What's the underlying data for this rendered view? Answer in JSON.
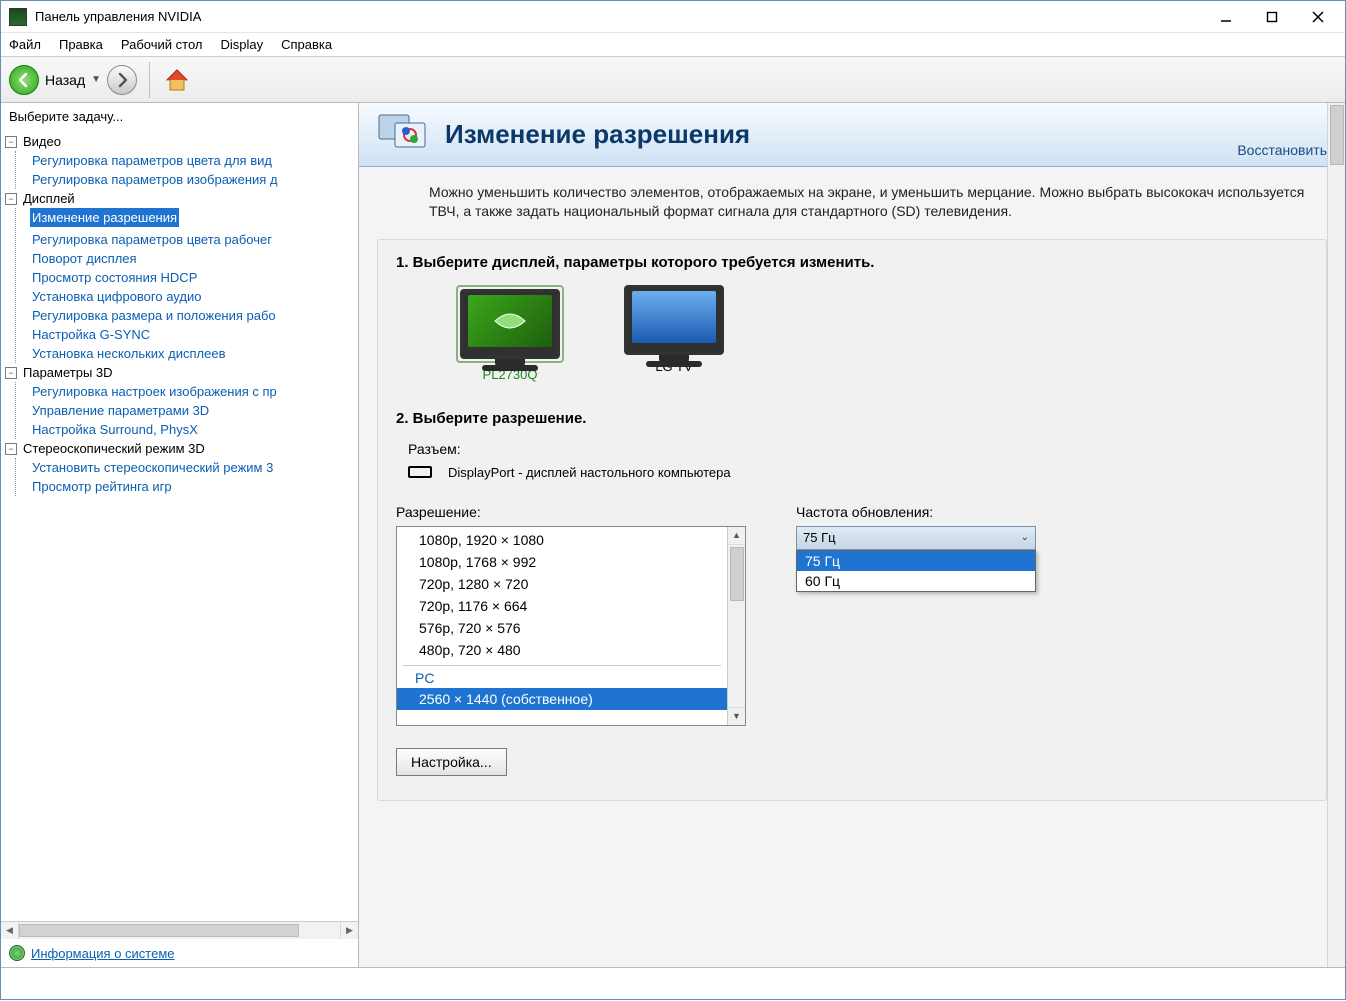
{
  "window": {
    "title": "Панель управления NVIDIA"
  },
  "menu": {
    "file": "Файл",
    "edit": "Правка",
    "desktop": "Рабочий стол",
    "display": "Display",
    "help": "Справка"
  },
  "toolbar": {
    "back_label": "Назад"
  },
  "sidebar": {
    "title": "Выберите задачу...",
    "groups": [
      {
        "label": "Видео",
        "items": [
          "Регулировка параметров цвета для вид",
          "Регулировка параметров изображения д"
        ]
      },
      {
        "label": "Дисплей",
        "items": [
          "Изменение разрешения",
          "Регулировка параметров цвета рабочег",
          "Поворот дисплея",
          "Просмотр состояния HDCP",
          "Установка цифрового аудио",
          "Регулировка размера и положения рабо",
          "Настройка G-SYNC",
          "Установка нескольких дисплеев"
        ],
        "selected": 0
      },
      {
        "label": "Параметры 3D",
        "items": [
          "Регулировка настроек изображения с пр",
          "Управление параметрами 3D",
          "Настройка Surround, PhysX"
        ]
      },
      {
        "label": "Стереоскопический режим 3D",
        "items": [
          "Установить стереоскопический режим 3",
          "Просмотр рейтинга игр"
        ]
      }
    ],
    "footer_link": "Информация о системе"
  },
  "main": {
    "title": "Изменение разрешения",
    "restore": "Восстановить",
    "description": "Можно уменьшить количество элементов, отображаемых на экране, и уменьшить мерцание. Можно выбрать высококач используется ТВЧ, а также задать национальный формат сигнала для стандартного (SD) телевидения.",
    "step1_heading": "1. Выберите дисплей, параметры которого требуется изменить.",
    "displays": [
      {
        "name": "PL2730Q",
        "selected": true
      },
      {
        "name": "LG TV",
        "selected": false
      }
    ],
    "step2_heading": "2. Выберите разрешение.",
    "connector_label": "Разъем:",
    "connector_value": "DisplayPort - дисплей настольного компьютера",
    "resolution_label": "Разрешение:",
    "resolutions_visible": [
      "1080p, 1920 × 1080",
      "1080p, 1768 × 992",
      "720p, 1280 × 720",
      "720p, 1176 × 664",
      "576p, 720 × 576",
      "480p, 720 × 480"
    ],
    "resolution_group_label": "PC",
    "resolution_selected": "2560 × 1440 (собственное)",
    "refresh_label": "Частота обновления:",
    "refresh_selected": "75 Гц",
    "refresh_options": [
      "75 Гц",
      "60 Гц"
    ],
    "customize_button": "Настройка..."
  }
}
